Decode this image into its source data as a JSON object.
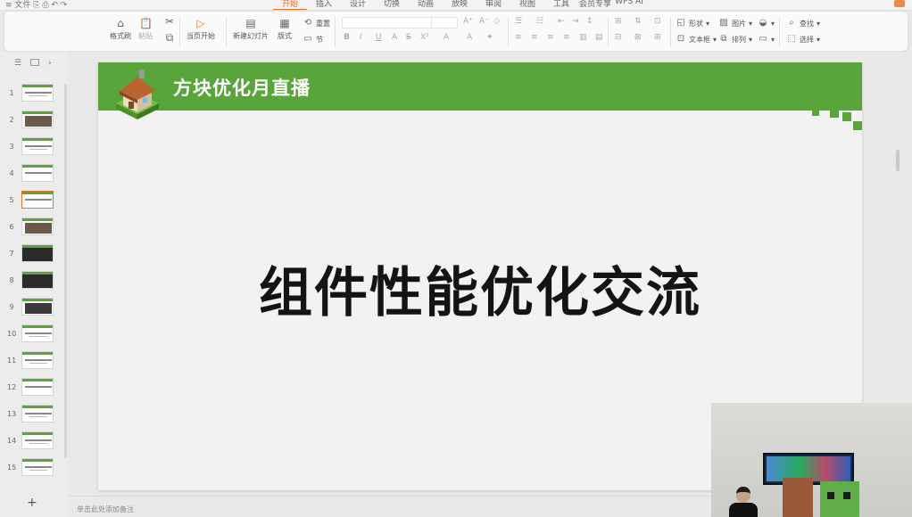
{
  "topbar": {
    "quick_access": "≡ 文件  ⎘  ⎙  ↶  ↷",
    "tabs": [
      "开始",
      "插入",
      "设计",
      "切换",
      "动画",
      "放映",
      "审阅",
      "视图",
      "工具",
      "会员专享",
      "WPS AI"
    ],
    "active_tab": "开始"
  },
  "ribbon": {
    "format_painter": "格式刷",
    "paste": "粘贴",
    "play_from_current": "当页开始",
    "new_slide": "新建幻灯片",
    "layout": "版式",
    "reset": "重置",
    "section": "节",
    "shape": "形状",
    "image": "图片",
    "textbox": "文本框",
    "arrange": "排列",
    "find": "查找",
    "select": "选择",
    "format_buttons": [
      "B",
      "I",
      "U",
      "A",
      "S",
      "X²",
      "A",
      "A"
    ]
  },
  "slides": {
    "numbers": [
      "1",
      "2",
      "3",
      "4",
      "5",
      "6",
      "7",
      "8",
      "9",
      "10",
      "11",
      "12",
      "13",
      "14",
      "15"
    ],
    "selected": 5
  },
  "slide": {
    "header_title": "方块优化月直播",
    "main_text": "组件性能优化交流"
  },
  "notes_placeholder": "单击此处添加备注",
  "add_slide_label": "+",
  "colors": {
    "header_green": "#5aa43c",
    "accent_orange": "#e8742a"
  }
}
